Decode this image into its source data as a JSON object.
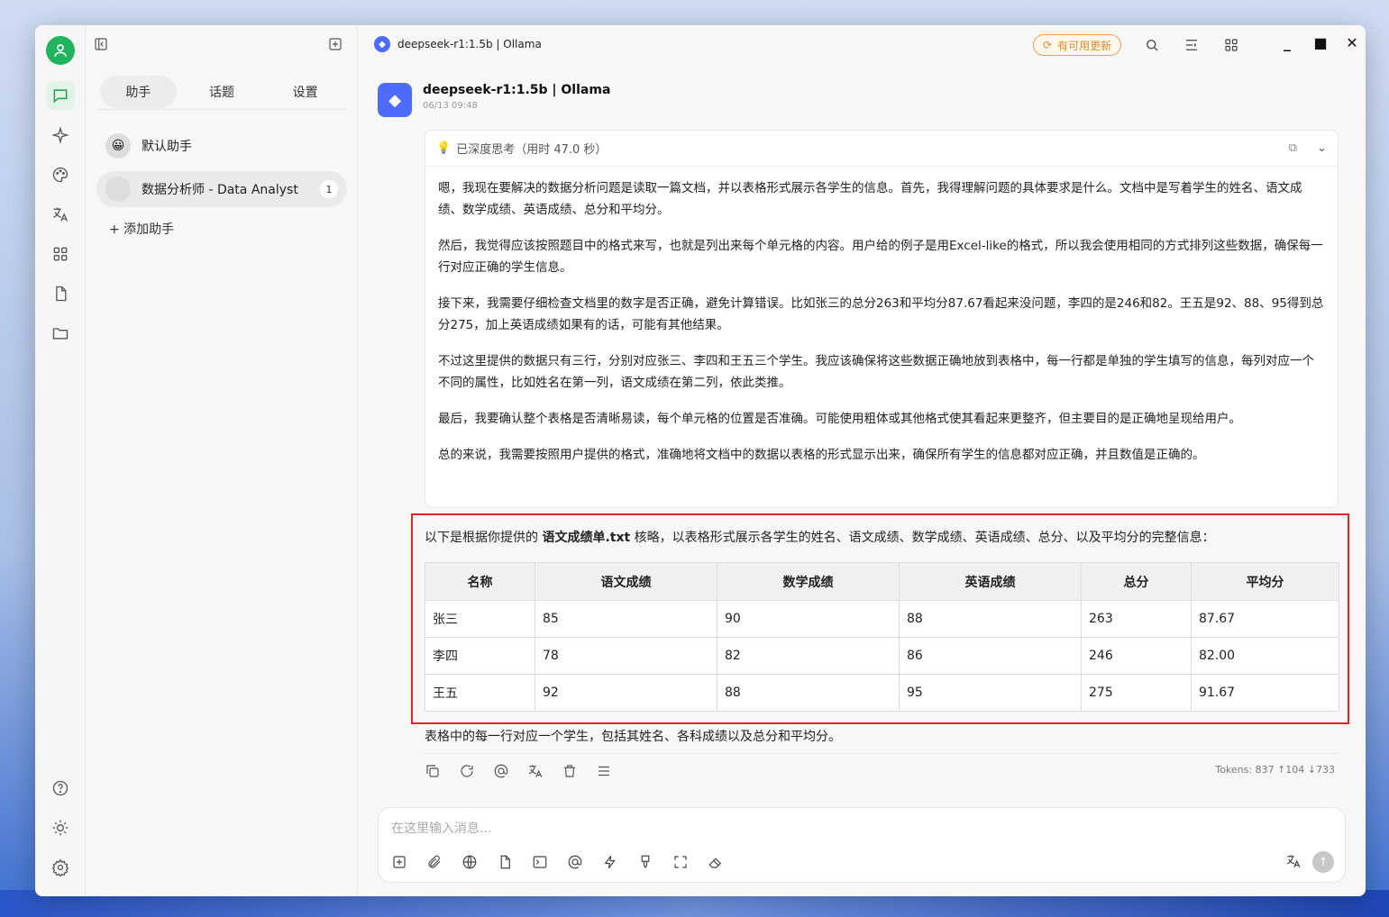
{
  "window": {
    "title": "deepseek-r1:1.5b | Ollama",
    "update_label": "有可用更新",
    "controls": {
      "minimize": "_",
      "maximize": "■",
      "close": "✕"
    }
  },
  "rail": {
    "avatar_icon": "user-icon",
    "items": [
      "chat-icon",
      "sparkle-icon",
      "palette-icon",
      "translate-icon",
      "apps-icon",
      "document-icon",
      "folder-icon"
    ],
    "bottom_items": [
      "help-icon",
      "theme-icon",
      "settings-icon"
    ]
  },
  "panel": {
    "tabs": [
      "助手",
      "话题",
      "设置"
    ],
    "active_tab": "助手",
    "assistants": [
      {
        "name": "默认助手",
        "avatar": "😀",
        "count": ""
      },
      {
        "name": "数据分析师 - Data Analyst",
        "avatar": "",
        "count": "1"
      }
    ],
    "add_assistant": "+ 添加助手"
  },
  "message": {
    "model": "deepseek-r1:1.5b | Ollama",
    "time": "06/13 09:48",
    "thinking_label": "已深度思考（用时 47.0 秒）",
    "thinking_paragraphs": [
      "嗯，我现在要解决的数据分析问题是读取一篇文档，并以表格形式展示各学生的信息。首先，我得理解问题的具体要求是什么。文档中是写着学生的姓名、语文成绩、数学成绩、英语成绩、总分和平均分。",
      "然后，我觉得应该按照题目中的格式来写，也就是列出来每个单元格的内容。用户给的例子是用Excel-like的格式，所以我会使用相同的方式排列这些数据，确保每一行对应正确的学生信息。",
      "接下来，我需要仔细检查文档里的数字是否正确，避免计算错误。比如张三的总分263和平均分87.67看起来没问题，李四的是246和82。王五是92、88、95得到总分275，加上英语成绩如果有的话，可能有其他结果。",
      "不过这里提供的数据只有三行，分别对应张三、李四和王五三个学生。我应该确保将这些数据正确地放到表格中，每一行都是单独的学生填写的信息，每列对应一个不同的属性，比如姓名在第一列，语文成绩在第二列，依此类推。",
      "最后，我要确认整个表格是否清晰易读，每个单元格的位置是否准确。可能使用粗体或其他格式使其看起来更整齐，但主要目的是正确地呈现给用户。",
      "总的来说，我需要按照用户提供的格式，准确地将文档中的数据以表格的形式显示出来，确保所有学生的信息都对应正确，并且数值是正确的。"
    ],
    "answer_intro_pre": "以下是根据你提供的 ",
    "answer_intro_file": "语文成绩单.txt",
    "answer_intro_post": " 核略，以表格形式展示各学生的姓名、语文成绩、数学成绩、英语成绩、总分、以及平均分的完整信息：",
    "table": {
      "headers": [
        "名称",
        "语文成绩",
        "数学成绩",
        "英语成绩",
        "总分",
        "平均分"
      ],
      "rows": [
        [
          "张三",
          "85",
          "90",
          "88",
          "263",
          "87.67"
        ],
        [
          "李四",
          "78",
          "82",
          "86",
          "246",
          "82.00"
        ],
        [
          "王五",
          "92",
          "88",
          "95",
          "275",
          "91.67"
        ]
      ]
    },
    "answer_outro": "表格中的每一行对应一个学生，包括其姓名、各科成绩以及总分和平均分。",
    "tokens": "Tokens: 837 ↑104 ↓733"
  },
  "composer": {
    "placeholder": "在这里输入消息...",
    "value": ""
  }
}
